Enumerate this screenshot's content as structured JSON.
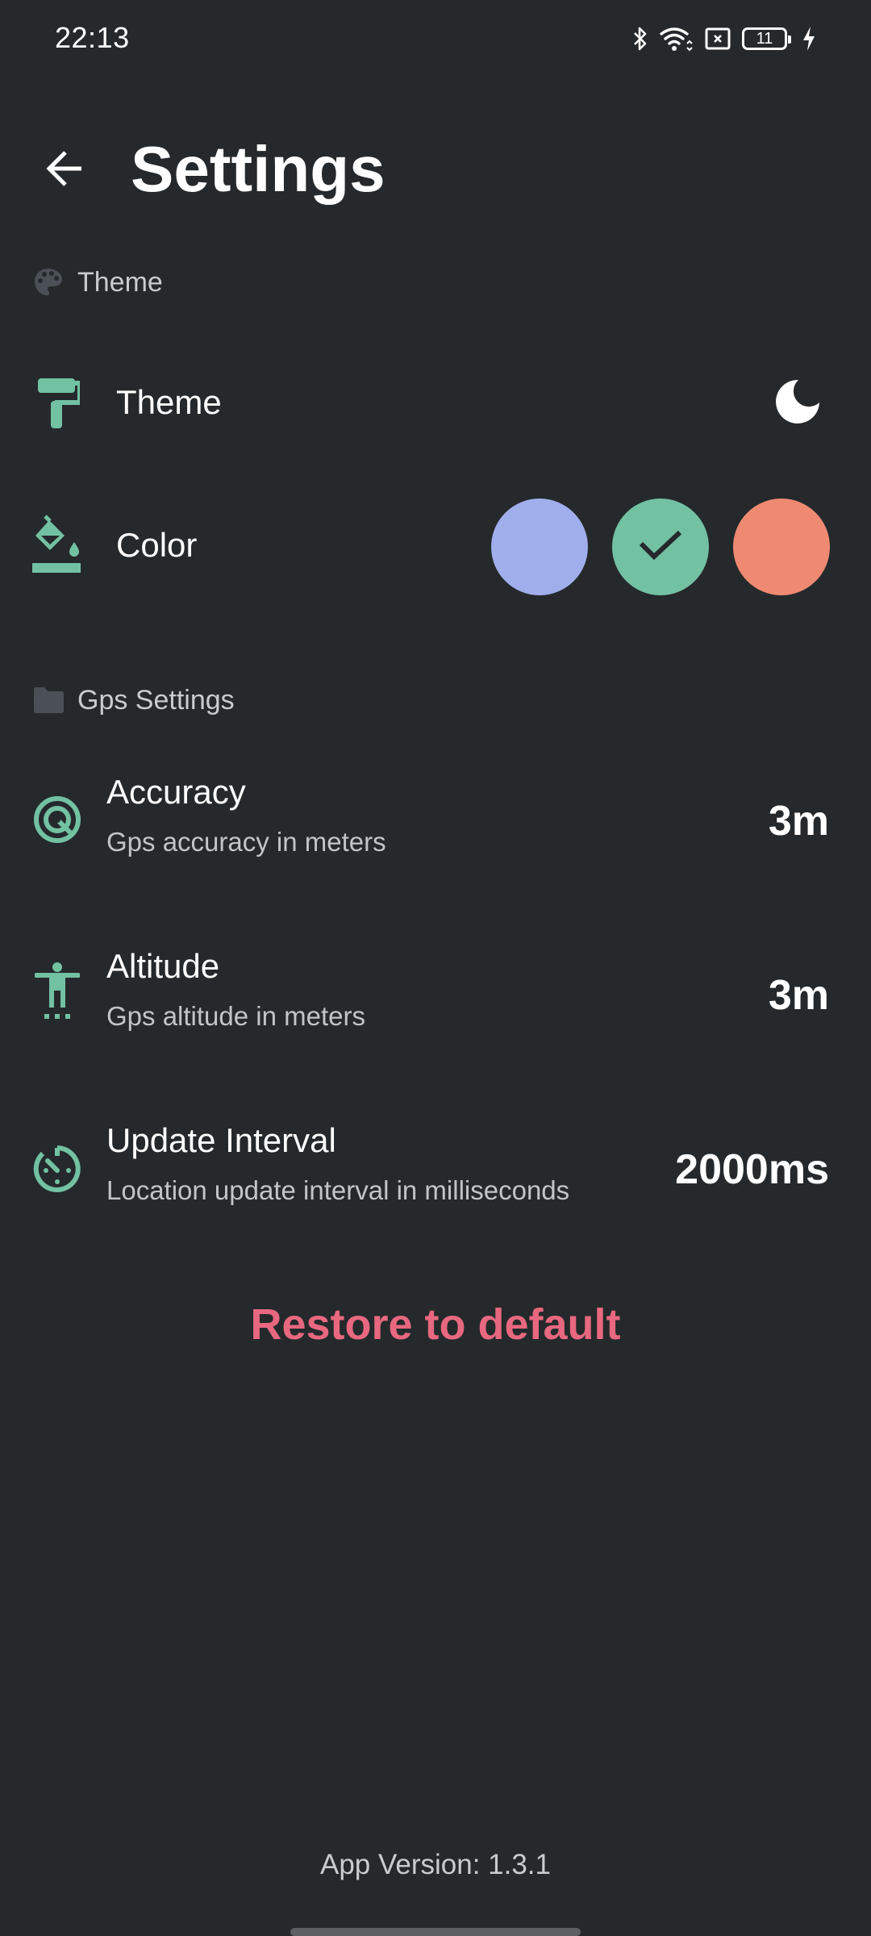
{
  "status_bar": {
    "time": "22:13",
    "battery_level": "11",
    "icons": [
      "bluetooth-icon",
      "wifi-icon",
      "no-sim-icon",
      "battery-icon",
      "charging-icon"
    ]
  },
  "header": {
    "back_icon": "arrow-left-icon",
    "title": "Settings"
  },
  "sections": {
    "theme": {
      "icon": "palette-icon",
      "label": "Theme",
      "items": {
        "theme": {
          "icon": "paint-roller-icon",
          "title": "Theme",
          "value_icon": "moon-icon",
          "value": "dark"
        },
        "color": {
          "icon": "format-color-fill-icon",
          "title": "Color",
          "options": [
            {
              "name": "lavender",
              "hex": "#a1aeec",
              "selected": false
            },
            {
              "name": "green",
              "hex": "#72c1a3",
              "selected": true
            },
            {
              "name": "salmon",
              "hex": "#ef8a72",
              "selected": false
            }
          ]
        }
      }
    },
    "gps": {
      "icon": "folder-icon",
      "label": "Gps Settings",
      "items": [
        {
          "icon": "radar-target-icon",
          "title": "Accuracy",
          "summary": "Gps accuracy in meters",
          "value": "3m"
        },
        {
          "icon": "altitude-person-icon",
          "title": "Altitude",
          "summary": "Gps altitude in meters",
          "value": "3m"
        },
        {
          "icon": "timer-interval-icon",
          "title": "Update Interval",
          "summary": "Location update interval in milliseconds",
          "value": "2000ms"
        }
      ]
    }
  },
  "restore_label": "Restore to default",
  "app_version": "App Version: 1.3.1",
  "colors": {
    "background": "#25292b",
    "accent": "#72c1a3",
    "danger": "#e7687f",
    "section_icon": "#4a5055"
  }
}
